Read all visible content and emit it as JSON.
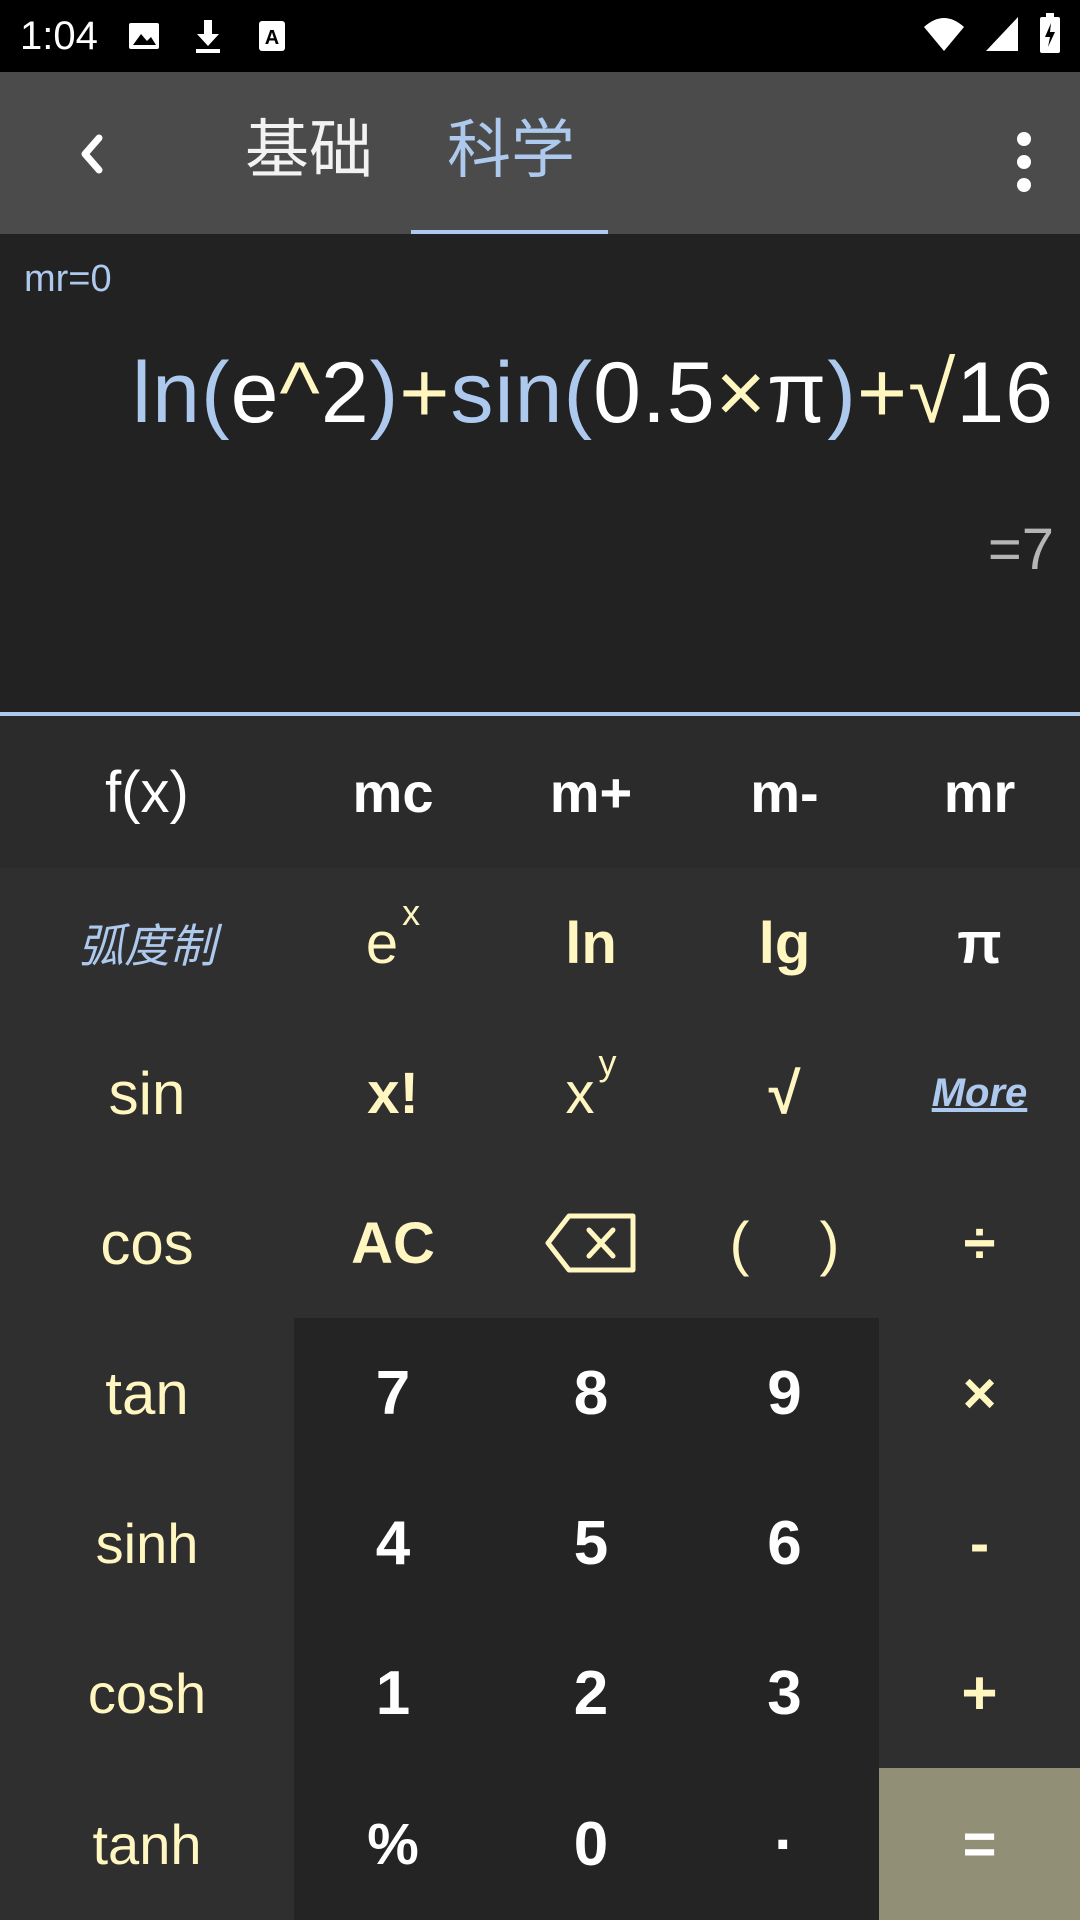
{
  "status_bar": {
    "time": "1:04",
    "icons": [
      "image-icon",
      "download-icon",
      "font-icon",
      "wifi-icon",
      "signal-icon",
      "battery-icon"
    ]
  },
  "app_bar": {
    "back_icon": "chevron-left-icon",
    "tabs": [
      {
        "label": "基础",
        "selected": false
      },
      {
        "label": "科学",
        "selected": true
      }
    ],
    "menu_icon": "more-vert-icon"
  },
  "display": {
    "memory": "mr=0",
    "expression": {
      "ln": "ln",
      "open1": "(",
      "e": "e",
      "pow": "^",
      "two": "2",
      "close1": ")",
      "plus1": "+",
      "sin": "sin",
      "open2": "(",
      "half": "0.5",
      "times": "×",
      "pi": "π",
      "close2": ")",
      "plus2": "+",
      "sqrt": "√",
      "sixteen": "16"
    },
    "result": "=7"
  },
  "keys": {
    "fx": "f(x)",
    "mc": "mc",
    "mplus": "m+",
    "mminus": "m-",
    "mr": "mr",
    "radian": "弧度制",
    "ex_base": "e",
    "ex_sup": "x",
    "ln": "ln",
    "lg": "lg",
    "pi": "π",
    "sin": "sin",
    "factorial": "x!",
    "xy_base": "x",
    "xy_sup": "y",
    "sqrt": "√",
    "more": "More",
    "cos": "cos",
    "ac": "AC",
    "paren_open": "(",
    "paren_close": ")",
    "divide": "÷",
    "tan": "tan",
    "seven": "7",
    "eight": "8",
    "nine": "9",
    "multiply": "×",
    "sinh": "sinh",
    "four": "4",
    "five": "5",
    "six": "6",
    "minus": "-",
    "cosh": "cosh",
    "one": "1",
    "two": "2",
    "three": "3",
    "plus": "+",
    "tanh": "tanh",
    "percent": "%",
    "zero": "0",
    "dot": "·",
    "equals": "="
  },
  "colors": {
    "accent_blue": "#aec9ee",
    "accent_yellow": "#fff6c0",
    "equals_bg": "#928f77"
  }
}
